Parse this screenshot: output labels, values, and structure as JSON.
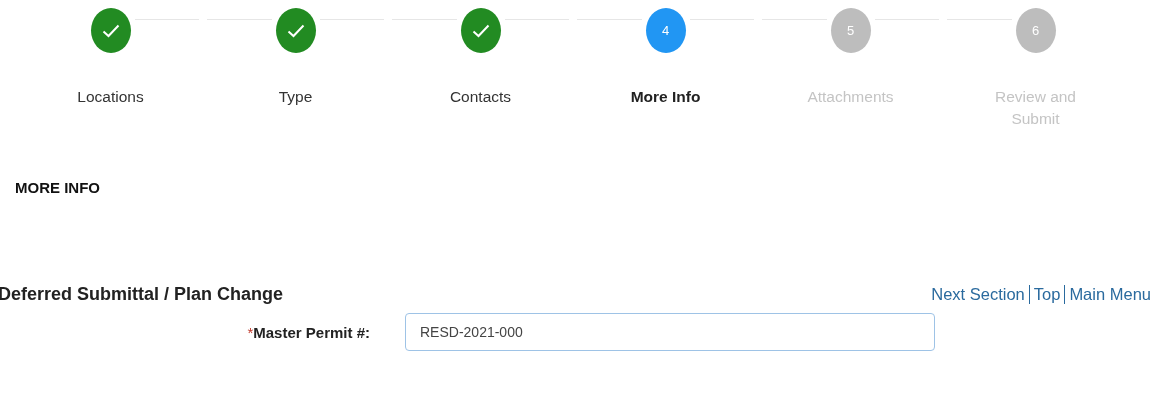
{
  "steps": [
    {
      "label": "Locations",
      "kind": "done"
    },
    {
      "label": "Type",
      "kind": "done"
    },
    {
      "label": "Contacts",
      "kind": "done"
    },
    {
      "number": "4",
      "label": "More Info",
      "kind": "current"
    },
    {
      "number": "5",
      "label": "Attachments",
      "kind": "upcoming"
    },
    {
      "number": "6",
      "label": "Review and Submit",
      "kind": "upcoming"
    }
  ],
  "page_heading": "MORE INFO",
  "section": {
    "title": "Deferred Submittal / Plan Change",
    "links": [
      "Next Section",
      "Top",
      "Main Menu"
    ]
  },
  "fields": [
    {
      "required_mark": "*",
      "label": "Master Permit #:",
      "value": "RESD-2021-000"
    }
  ]
}
